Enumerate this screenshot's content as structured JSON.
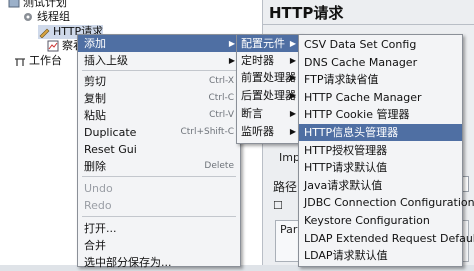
{
  "tree": {
    "items": [
      {
        "label": "测试计划"
      },
      {
        "label": "线程组"
      },
      {
        "label": "HTTP请求"
      },
      {
        "label": "察看"
      },
      {
        "label": "工作台"
      }
    ]
  },
  "right_panel": {
    "title": "HTTP请求",
    "impl_label": "Impl",
    "path_label": "路径：",
    "params_label": "Para"
  },
  "main_menu": {
    "items": [
      {
        "label": "添加",
        "shortcut": "",
        "submenu": true,
        "highlighted": true,
        "disabled": false
      },
      {
        "label": "插入上级",
        "shortcut": "",
        "submenu": true,
        "highlighted": false,
        "disabled": false
      },
      {
        "label": "剪切",
        "shortcut": "Ctrl-X",
        "submenu": false,
        "highlighted": false,
        "disabled": false
      },
      {
        "label": "复制",
        "shortcut": "Ctrl-C",
        "submenu": false,
        "highlighted": false,
        "disabled": false
      },
      {
        "label": "粘贴",
        "shortcut": "Ctrl-V",
        "submenu": false,
        "highlighted": false,
        "disabled": false
      },
      {
        "label": "Duplicate",
        "shortcut": "Ctrl+Shift-C",
        "submenu": false,
        "highlighted": false,
        "disabled": false
      },
      {
        "label": "Reset Gui",
        "shortcut": "",
        "submenu": false,
        "highlighted": false,
        "disabled": false
      },
      {
        "label": "删除",
        "shortcut": "Delete",
        "submenu": false,
        "highlighted": false,
        "disabled": false
      },
      {
        "label": "Undo",
        "shortcut": "",
        "submenu": false,
        "highlighted": false,
        "disabled": true
      },
      {
        "label": "Redo",
        "shortcut": "",
        "submenu": false,
        "highlighted": false,
        "disabled": true
      },
      {
        "label": "打开...",
        "shortcut": "",
        "submenu": false,
        "highlighted": false,
        "disabled": false
      },
      {
        "label": "合并",
        "shortcut": "",
        "submenu": false,
        "highlighted": false,
        "disabled": false
      },
      {
        "label": "选中部分保存为...",
        "shortcut": "",
        "submenu": false,
        "highlighted": false,
        "disabled": false
      }
    ]
  },
  "add_menu": {
    "items": [
      {
        "label": "配置元件",
        "highlighted": true
      },
      {
        "label": "定时器",
        "highlighted": false
      },
      {
        "label": "前置处理器",
        "highlighted": false
      },
      {
        "label": "后置处理器",
        "highlighted": false
      },
      {
        "label": "断言",
        "highlighted": false
      },
      {
        "label": "监听器",
        "highlighted": false
      }
    ]
  },
  "config_menu": {
    "items": [
      {
        "label": "CSV Data Set Config",
        "highlighted": false
      },
      {
        "label": "DNS Cache Manager",
        "highlighted": false
      },
      {
        "label": "FTP请求缺省值",
        "highlighted": false
      },
      {
        "label": "HTTP Cache Manager",
        "highlighted": false
      },
      {
        "label": "HTTP Cookie 管理器",
        "highlighted": false
      },
      {
        "label": "HTTP信息头管理器",
        "highlighted": true
      },
      {
        "label": "HTTP授权管理器",
        "highlighted": false
      },
      {
        "label": "HTTP请求默认值",
        "highlighted": false
      },
      {
        "label": "Java请求默认值",
        "highlighted": false
      },
      {
        "label": "JDBC Connection Configuration",
        "highlighted": false
      },
      {
        "label": "Keystore Configuration",
        "highlighted": false
      },
      {
        "label": "LDAP Extended Request Defaults",
        "highlighted": false
      },
      {
        "label": "LDAP请求默认值",
        "highlighted": false
      }
    ]
  },
  "colors": {
    "highlight": "#4f6fa3",
    "menu_bg": "#f3f4f6"
  }
}
